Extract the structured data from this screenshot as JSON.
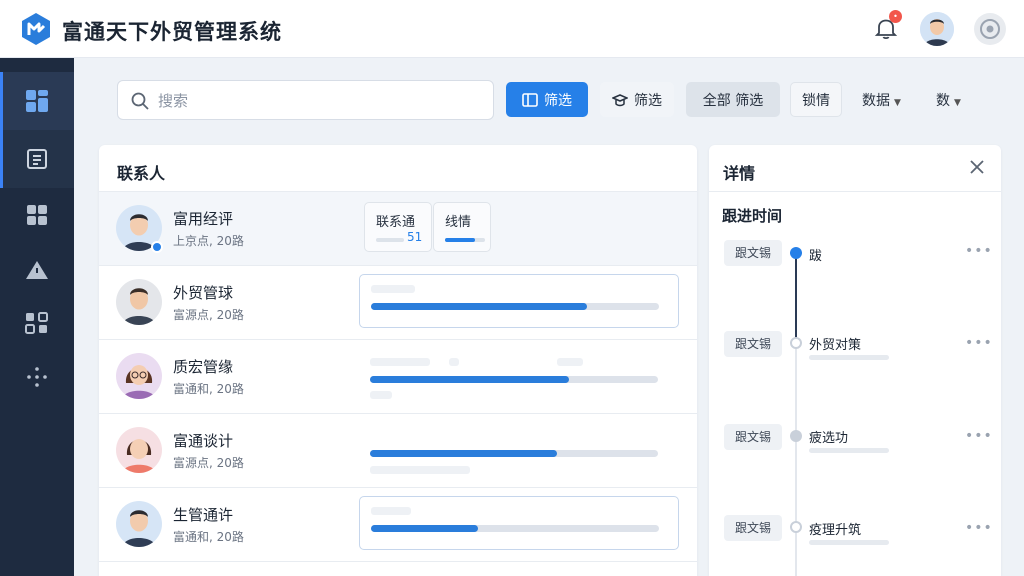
{
  "header": {
    "title": "富通天下外贸管理系统",
    "notification_count": "•"
  },
  "sidebar": {
    "items": [
      {
        "icon": "dashboard-icon"
      },
      {
        "icon": "document-icon"
      },
      {
        "icon": "apps-grid-icon"
      },
      {
        "icon": "alert-icon"
      },
      {
        "icon": "network-icon"
      },
      {
        "icon": "more-dots-icon"
      }
    ]
  },
  "toolbar": {
    "search_placeholder": "搜索",
    "filter_primary": "筛选",
    "filter_secondary": "筛选",
    "filter_all": "全部  筛选",
    "details_btn": "锁情",
    "dropdown_1": "数据",
    "dropdown_2": "数"
  },
  "contacts": {
    "title": "联系人",
    "rows": [
      {
        "name": "富用经评",
        "sub": "上京点, 20路",
        "mini_cards": [
          {
            "label": "联系通",
            "num": "51",
            "fill": 0.2
          },
          {
            "label": "线情",
            "fill": 0.75
          }
        ]
      },
      {
        "name": "外贸管球",
        "sub": "富源点, 20路",
        "progress": 0.75
      },
      {
        "name": "质宏管缘",
        "sub": "富通和, 20路",
        "progress": 0.69
      },
      {
        "name": "富通谈计",
        "sub": "富源点, 20路",
        "progress": 0.65
      },
      {
        "name": "生管通许",
        "sub": "富通和, 20路",
        "progress": 0.37
      }
    ]
  },
  "detail": {
    "title": "详情",
    "section": "跟进时间",
    "timeline": [
      {
        "tag": "跟文锡",
        "text": "跋",
        "state": "active"
      },
      {
        "tag": "跟文锡",
        "text": "外贸对策",
        "state": "open"
      },
      {
        "tag": "跟文锡",
        "text": "疲选功",
        "state": "gray"
      },
      {
        "tag": "跟文锡",
        "text": "疫理升筑",
        "state": "open"
      }
    ],
    "more": "•••"
  },
  "colors": {
    "primary": "#2680e8",
    "sidebar": "#1e2b40",
    "background": "#eef2f7"
  }
}
